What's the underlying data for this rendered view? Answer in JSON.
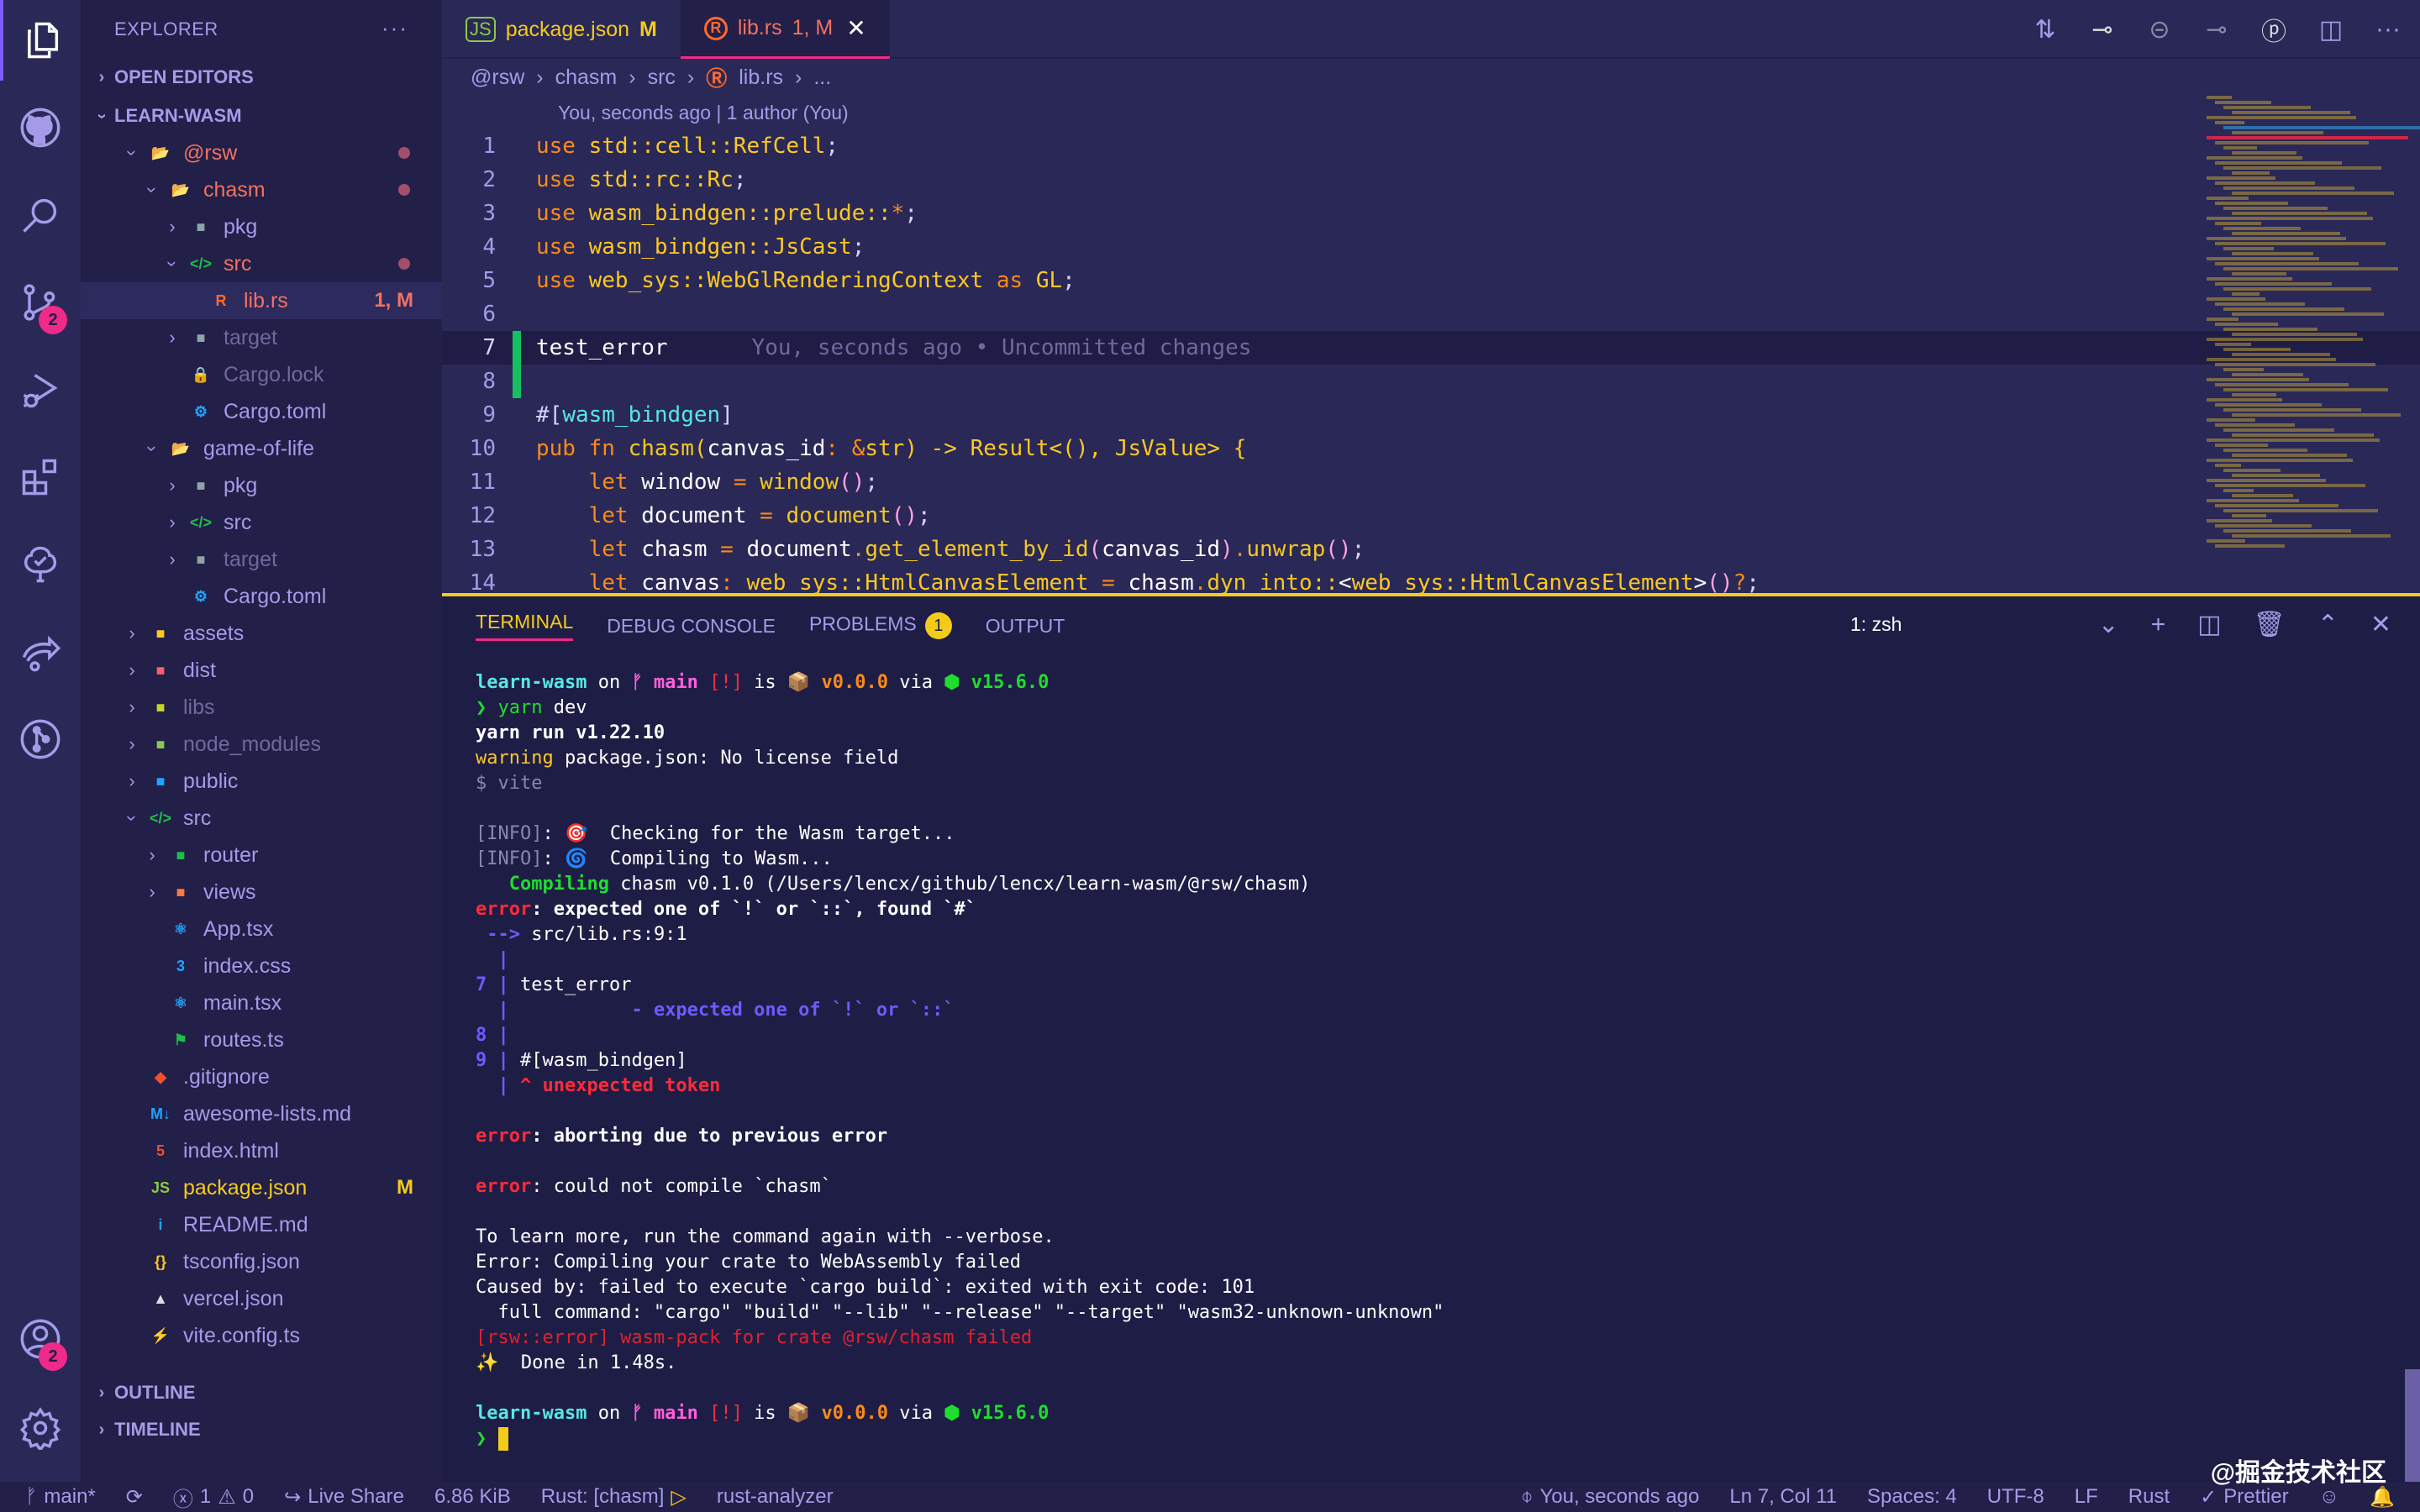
{
  "activity": {
    "items": [
      {
        "name": "explorer-icon"
      },
      {
        "name": "github-icon"
      },
      {
        "name": "search-icon"
      },
      {
        "name": "source-control-icon",
        "badge": "2"
      },
      {
        "name": "run-debug-icon"
      },
      {
        "name": "extensions-icon"
      },
      {
        "name": "tree-check-icon"
      },
      {
        "name": "live-share-icon"
      },
      {
        "name": "git-graph-icon"
      }
    ],
    "accounts_badge": "2"
  },
  "sidebar": {
    "title": "EXPLORER",
    "open_editors": "OPEN EDITORS",
    "workspace": "LEARN-WASM",
    "outline": "OUTLINE",
    "timeline": "TIMELINE",
    "tree": [
      {
        "label": "@rsw",
        "depth": 1,
        "type": "folder-open",
        "state": "mod",
        "dot": true
      },
      {
        "label": "chasm",
        "depth": 2,
        "type": "folder-open",
        "state": "mod",
        "dot": true
      },
      {
        "label": "pkg",
        "depth": 3,
        "type": "folder",
        "state": ""
      },
      {
        "label": "src",
        "depth": 3,
        "type": "folder-src-open",
        "state": "mod",
        "dot": true
      },
      {
        "label": "lib.rs",
        "depth": 4,
        "type": "rust",
        "state": "mod",
        "deco": "1, M",
        "selected": true
      },
      {
        "label": "target",
        "depth": 3,
        "type": "folder",
        "state": "dim"
      },
      {
        "label": "Cargo.lock",
        "depth": 3,
        "type": "lock",
        "state": "dim"
      },
      {
        "label": "Cargo.toml",
        "depth": 3,
        "type": "gear",
        "state": ""
      },
      {
        "label": "game-of-life",
        "depth": 2,
        "type": "folder-open",
        "state": ""
      },
      {
        "label": "pkg",
        "depth": 3,
        "type": "folder",
        "state": ""
      },
      {
        "label": "src",
        "depth": 3,
        "type": "folder-src",
        "state": ""
      },
      {
        "label": "target",
        "depth": 3,
        "type": "folder",
        "state": "dim"
      },
      {
        "label": "Cargo.toml",
        "depth": 3,
        "type": "gear",
        "state": ""
      },
      {
        "label": "assets",
        "depth": 1,
        "type": "folder-assets",
        "state": ""
      },
      {
        "label": "dist",
        "depth": 1,
        "type": "folder-dist",
        "state": ""
      },
      {
        "label": "libs",
        "depth": 1,
        "type": "folder-libs",
        "state": "dim"
      },
      {
        "label": "node_modules",
        "depth": 1,
        "type": "folder-node",
        "state": "dim"
      },
      {
        "label": "public",
        "depth": 1,
        "type": "folder-public",
        "state": ""
      },
      {
        "label": "src",
        "depth": 1,
        "type": "folder-src-open",
        "state": ""
      },
      {
        "label": "router",
        "depth": 2,
        "type": "folder-router",
        "state": ""
      },
      {
        "label": "views",
        "depth": 2,
        "type": "folder-views",
        "state": ""
      },
      {
        "label": "App.tsx",
        "depth": 2,
        "type": "react",
        "state": ""
      },
      {
        "label": "index.css",
        "depth": 2,
        "type": "css",
        "state": ""
      },
      {
        "label": "main.tsx",
        "depth": 2,
        "type": "react",
        "state": ""
      },
      {
        "label": "routes.ts",
        "depth": 2,
        "type": "routes",
        "state": ""
      },
      {
        "label": ".gitignore",
        "depth": 1,
        "type": "git",
        "state": ""
      },
      {
        "label": "awesome-lists.md",
        "depth": 1,
        "type": "markdown",
        "state": ""
      },
      {
        "label": "index.html",
        "depth": 1,
        "type": "html",
        "state": ""
      },
      {
        "label": "package.json",
        "depth": 1,
        "type": "nodejs",
        "state": "modified-y",
        "deco": "M"
      },
      {
        "label": "README.md",
        "depth": 1,
        "type": "info",
        "state": ""
      },
      {
        "label": "tsconfig.json",
        "depth": 1,
        "type": "json",
        "state": ""
      },
      {
        "label": "vercel.json",
        "depth": 1,
        "type": "vercel",
        "state": ""
      },
      {
        "label": "vite.config.ts",
        "depth": 1,
        "type": "vite",
        "state": ""
      }
    ]
  },
  "tabs": [
    {
      "label": "package.json",
      "deco": "M",
      "icon": "nodejs-icon",
      "active": false
    },
    {
      "label": "lib.rs",
      "deco": "1, M",
      "icon": "rust-icon",
      "active": true
    }
  ],
  "breadcrumb": [
    "@rsw",
    "chasm",
    "src",
    "lib.rs",
    "..."
  ],
  "blame_header": "You, seconds ago | 1 author (You)",
  "code": {
    "current_line": 7,
    "inline_blame": "You, seconds ago • Uncommitted changes",
    "lines": [
      {
        "n": "1",
        "html": "<span class='kw'>use</span> <span class='ty'>std::cell::RefCell</span><span class='pu'>;</span>"
      },
      {
        "n": "2",
        "html": "<span class='kw'>use</span> <span class='ty'>std::rc::Rc</span><span class='pu'>;</span>"
      },
      {
        "n": "3",
        "html": "<span class='kw'>use</span> <span class='ty'>wasm_bindgen::prelude::</span><span class='op'>*</span><span class='pu'>;</span>"
      },
      {
        "n": "4",
        "html": "<span class='kw'>use</span> <span class='ty'>wasm_bindgen::JsCast</span><span class='pu'>;</span>"
      },
      {
        "n": "5",
        "html": "<span class='kw'>use</span> <span class='ty'>web_sys::WebGlRenderingContext</span> <span class='kw'>as</span> <span class='ty'>GL</span><span class='pu'>;</span>"
      },
      {
        "n": "6",
        "html": ""
      },
      {
        "n": "7",
        "html": "test_error"
      },
      {
        "n": "8",
        "html": ""
      },
      {
        "n": "9",
        "html": "<span class='pu'>#[</span><span class='at'>wasm_bindgen</span><span class='pu'>]</span>"
      },
      {
        "n": "10",
        "html": "<span class='kw'>pub fn</span> <span class='fn'>chasm</span><span class='ty'>(</span>canvas_id<span class='op'>:</span> <span class='op'>&amp;</span><span class='ty'>str) -&gt; Result&lt;(), JsValue&gt; {</span>"
      },
      {
        "n": "11",
        "html": "    <span class='kw'>let</span> window <span class='op'>=</span> <span class='fn'>window</span><span class='pa'>()</span><span class='pu'>;</span>"
      },
      {
        "n": "12",
        "html": "    <span class='kw'>let</span> document <span class='op'>=</span> <span class='fn'>document</span><span class='pa'>()</span><span class='pu'>;</span>"
      },
      {
        "n": "13",
        "html": "    <span class='kw'>let</span> chasm <span class='op'>=</span> document<span class='op'>.</span><span class='fn'>get_element_by_id</span><span class='pa'>(</span>canvas_id<span class='pa'>)</span><span class='op'>.</span><span class='fn'>unwrap</span><span class='pa'>()</span><span class='pu'>;</span>"
      },
      {
        "n": "14",
        "html": "    <span class='kw'>let</span> canvas<span class='op'>:</span> <span class='ty'>web_sys::HtmlCanvasElement</span> <span class='op'>=</span> chasm<span class='op'>.</span><span class='fn'>dyn_into::</span>&lt;<span class='ty'>web_sys::HtmlCanvasElement</span>&gt;<span class='pa'>()</span><span class='op'>?</span><span class='pu'>;</span>"
      }
    ]
  },
  "panel": {
    "tabs": [
      {
        "label": "TERMINAL",
        "active": true
      },
      {
        "label": "DEBUG CONSOLE",
        "active": false
      },
      {
        "label": "PROBLEMS",
        "active": false,
        "badge": "1"
      },
      {
        "label": "OUTPUT",
        "active": false
      }
    ],
    "terminal_name": "1: zsh"
  },
  "terminal": [
    "<span class='t-cyan'>learn-wasm</span> on <span class='t-pink'>ᚠ main</span> <span class='t-red'>[!]</span> is 📦 <span class='t-orange'>v0.0.0</span> via <span class='t-green'>⬢ v15.6.0</span>",
    "<span class='t-greenn'>❯ yarn</span> dev",
    "<span class='t-bold'>yarn run v1.22.10</span>",
    "<span class='t-yellow'>warning</span> package.json: No license field",
    "<span class='t-gray'>$ vite</span>",
    "",
    "<span class='t-gray'>[INFO]</span>: 🎯  Checking for the Wasm target...",
    "<span class='t-gray'>[INFO]</span>: 🌀  Compiling to Wasm...",
    "   <span class='t-green'>Compiling</span> chasm v0.1.0 (/Users/lencx/github/lencx/learn-wasm/@rsw/chasm)",
    "<span class='t-redb'>error</span><span class='t-bold'>: expected one of `!` or `::`, found `#`</span>",
    " <span class='t-blue'>--&gt;</span> src/lib.rs:9:1",
    "  <span class='t-blue'>|</span>",
    "<span class='t-blue'>7</span> <span class='t-blue'>|</span> test_error",
    "  <span class='t-blue'>|</span>           <span class='t-blue'>- expected one of `!` or `::`</span>",
    "<span class='t-blue'>8</span> <span class='t-blue'>|</span>",
    "<span class='t-blue'>9</span> <span class='t-blue'>|</span> #[wasm_bindgen]",
    "  <span class='t-blue'>|</span> <span class='t-redb'>^ unexpected token</span>",
    "",
    "<span class='t-redb'>error</span><span class='t-bold'>: aborting due to previous error</span>",
    "",
    "<span class='t-redb'>error</span>: could not compile `chasm`",
    "",
    "To learn more, run the command again with --verbose.",
    "Error: Compiling your crate to WebAssembly failed",
    "Caused by: failed to execute `cargo build`: exited with exit code: 101",
    "  full command: \"cargo\" \"build\" \"--lib\" \"--release\" \"--target\" \"wasm32-unknown-unknown\"",
    "<span class='t-redd'>[rsw::error] wasm-pack for crate @rsw/chasm failed</span>",
    "✨  Done in 1.48s.",
    "",
    "<span class='t-cyan'>learn-wasm</span> on <span class='t-pink'>ᚠ main</span> <span class='t-red'>[!]</span> is 📦 <span class='t-orange'>v0.0.0</span> via <span class='t-green'>⬢ v15.6.0</span>",
    "<span class='t-greenn'>❯</span> <span class='cursor'></span>"
  ],
  "status": {
    "branch": "main*",
    "errors": "1",
    "warnings": "0",
    "live_share": "Live Share",
    "file_size": "6.86 KiB",
    "rust_project": "Rust: [chasm]",
    "analyzer": "rust-analyzer",
    "blame": "You, seconds ago",
    "position": "Ln 7, Col 11",
    "spaces": "Spaces: 4",
    "encoding": "UTF-8",
    "eol": "LF",
    "language": "Rust",
    "prettier": "Prettier"
  },
  "watermark": "@掘金技术社区",
  "colors": {
    "accent": "#ef2a88",
    "warning": "#f3cc1a",
    "error": "#ff2b3a",
    "background": "#2a2856",
    "sidebar": "#221f48"
  }
}
